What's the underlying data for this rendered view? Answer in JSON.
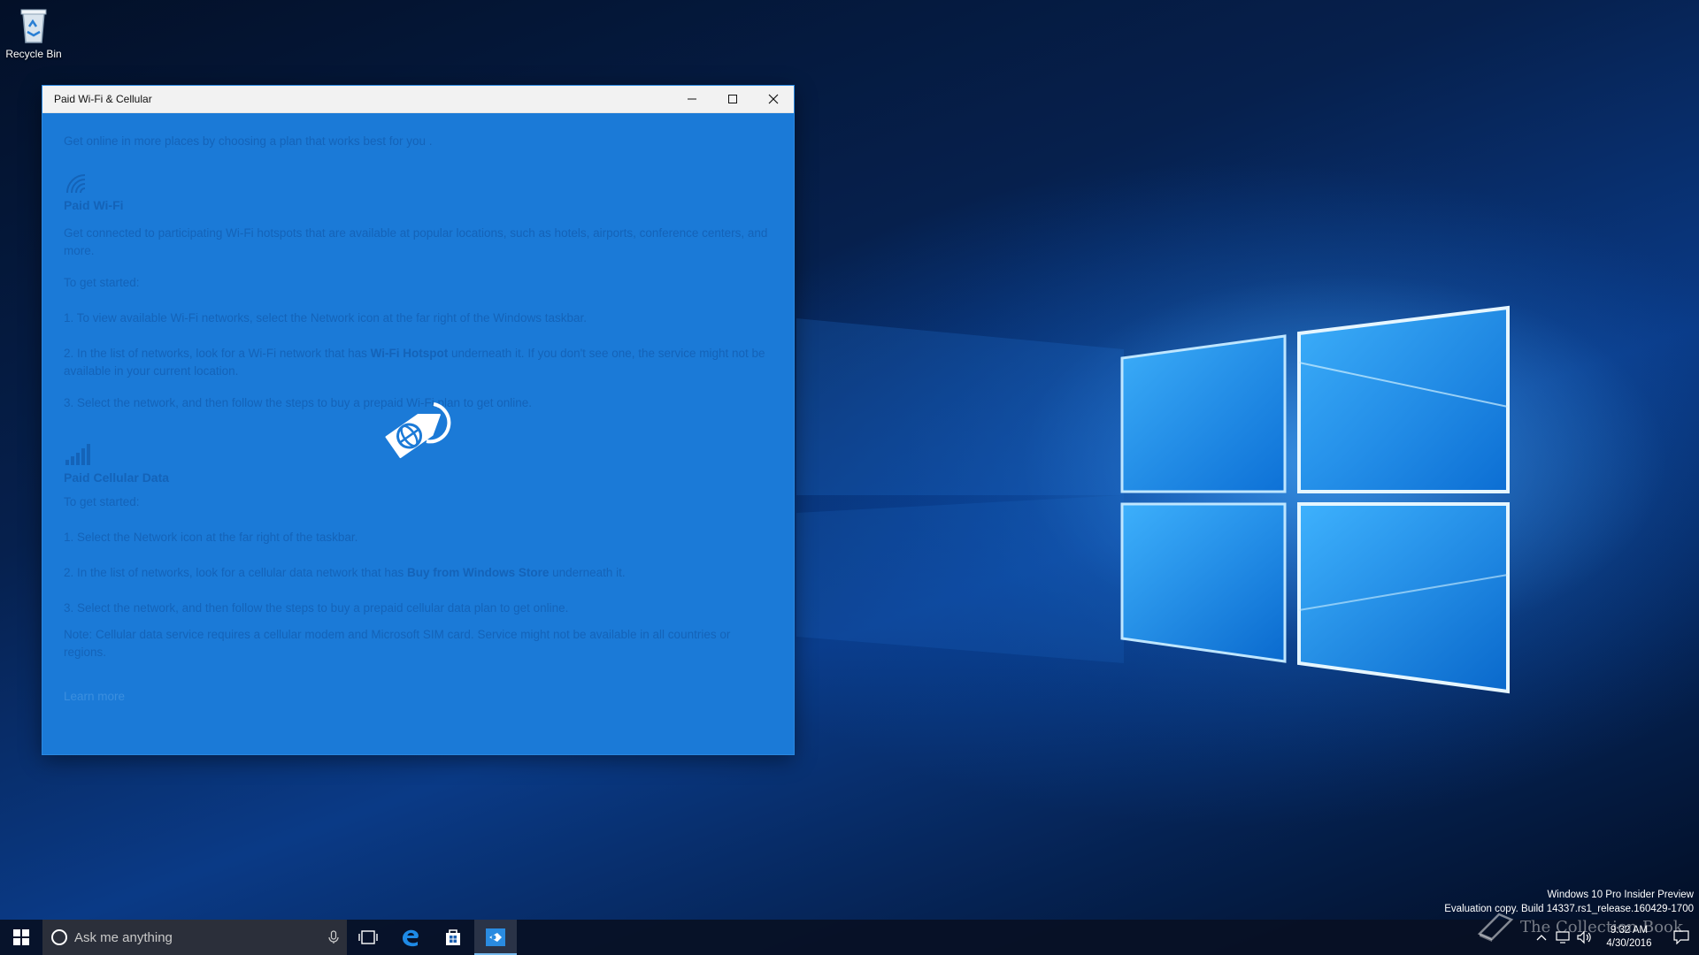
{
  "desktop": {
    "icons": [
      {
        "label": "Recycle Bin",
        "icon": "recycle-bin-icon"
      }
    ]
  },
  "window": {
    "title": "Paid Wi-Fi & Cellular",
    "controls": {
      "minimize": "minimize-icon",
      "maximize": "maximize-icon",
      "close": "close-icon"
    },
    "intro": "Get online in more places by choosing a plan that works best for you .",
    "wifi": {
      "icon": "wifi-icon",
      "heading": "Paid Wi-Fi",
      "description": "Get connected to participating Wi-Fi hotspots that are available at popular locations, such as hotels, airports, conference centers, and more.",
      "get_started": "To get started:",
      "step1": "1. To view available Wi-Fi networks, select the Network icon at the far right of the Windows taskbar.",
      "step2_pre": "2. In the list of networks, look for a Wi-Fi network that has ",
      "step2_bold": "Wi-Fi Hotspot",
      "step2_post": " underneath it. If you don't see one, the service might not be available in your current location.",
      "step3": "3. Select the network, and then follow the steps to buy a prepaid Wi-Fi plan to get online."
    },
    "cellular": {
      "icon": "signal-bars-icon",
      "heading": "Paid Cellular Data",
      "get_started": "To get started:",
      "step1": "1. Select the Network icon at the far right of the taskbar.",
      "step2_pre": "2. In the list of networks, look for a cellular data network that has ",
      "step2_bold": "Buy from Windows Store",
      "step2_post": " underneath it.",
      "step3": "3. Select the network, and then follow the steps to buy a prepaid cellular data plan to get online.",
      "note": "Note: Cellular data service requires a cellular modem and Microsoft SIM card. Service might not be available in all countries or regions."
    },
    "learn_more": "Learn more",
    "splash_icon": "globe-tag-icon"
  },
  "taskbar": {
    "search_placeholder": "Ask me anything",
    "pinned": [
      "task-view-icon",
      "edge-icon",
      "store-icon",
      "paid-wifi-app-icon"
    ],
    "clock_time": "9:32 AM",
    "clock_date": "4/30/2016"
  },
  "watermark": {
    "line1": "Windows 10 Pro Insider Preview",
    "line2": "Evaluation copy. Build 14337.rs1_release.160429-1700"
  },
  "overlay_logo": "The Collection Book",
  "colors": {
    "app_background": "#1b7ad7",
    "text": "#1463b8",
    "taskbar": "#081024"
  }
}
